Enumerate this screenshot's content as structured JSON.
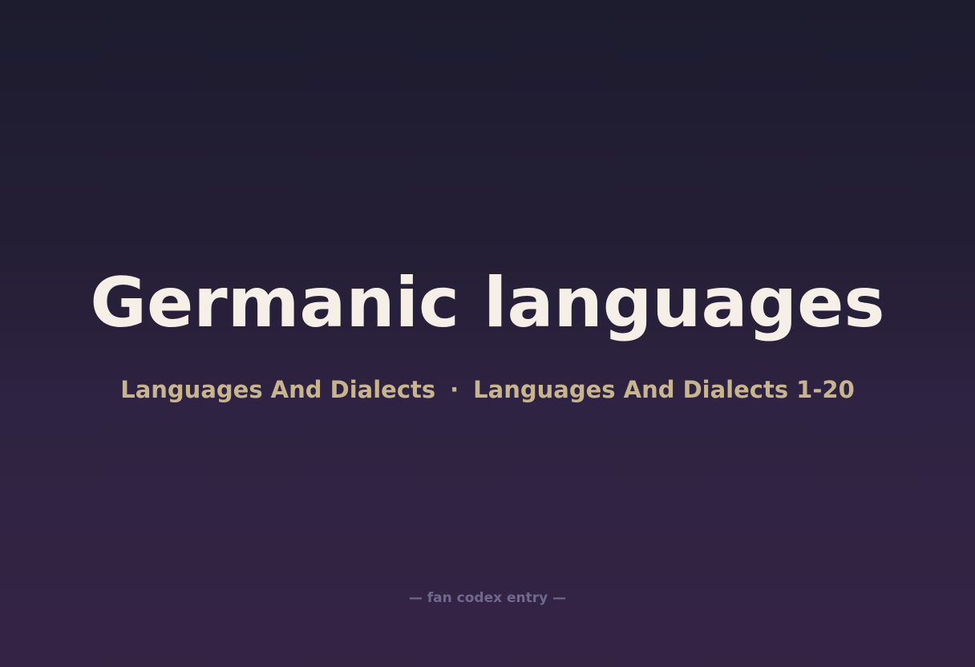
{
  "title": "Germanic languages",
  "subtitle": {
    "category": "Languages And Dialects",
    "separator": "·",
    "range": "Languages And Dialects 1-20"
  },
  "footer": "— fan codex entry —",
  "colors": {
    "title": "#f5efe7",
    "subtitle": "#c8b48f",
    "footer": "#6f6990",
    "background_top": "#1d1b2e",
    "background_bottom": "#352344"
  }
}
